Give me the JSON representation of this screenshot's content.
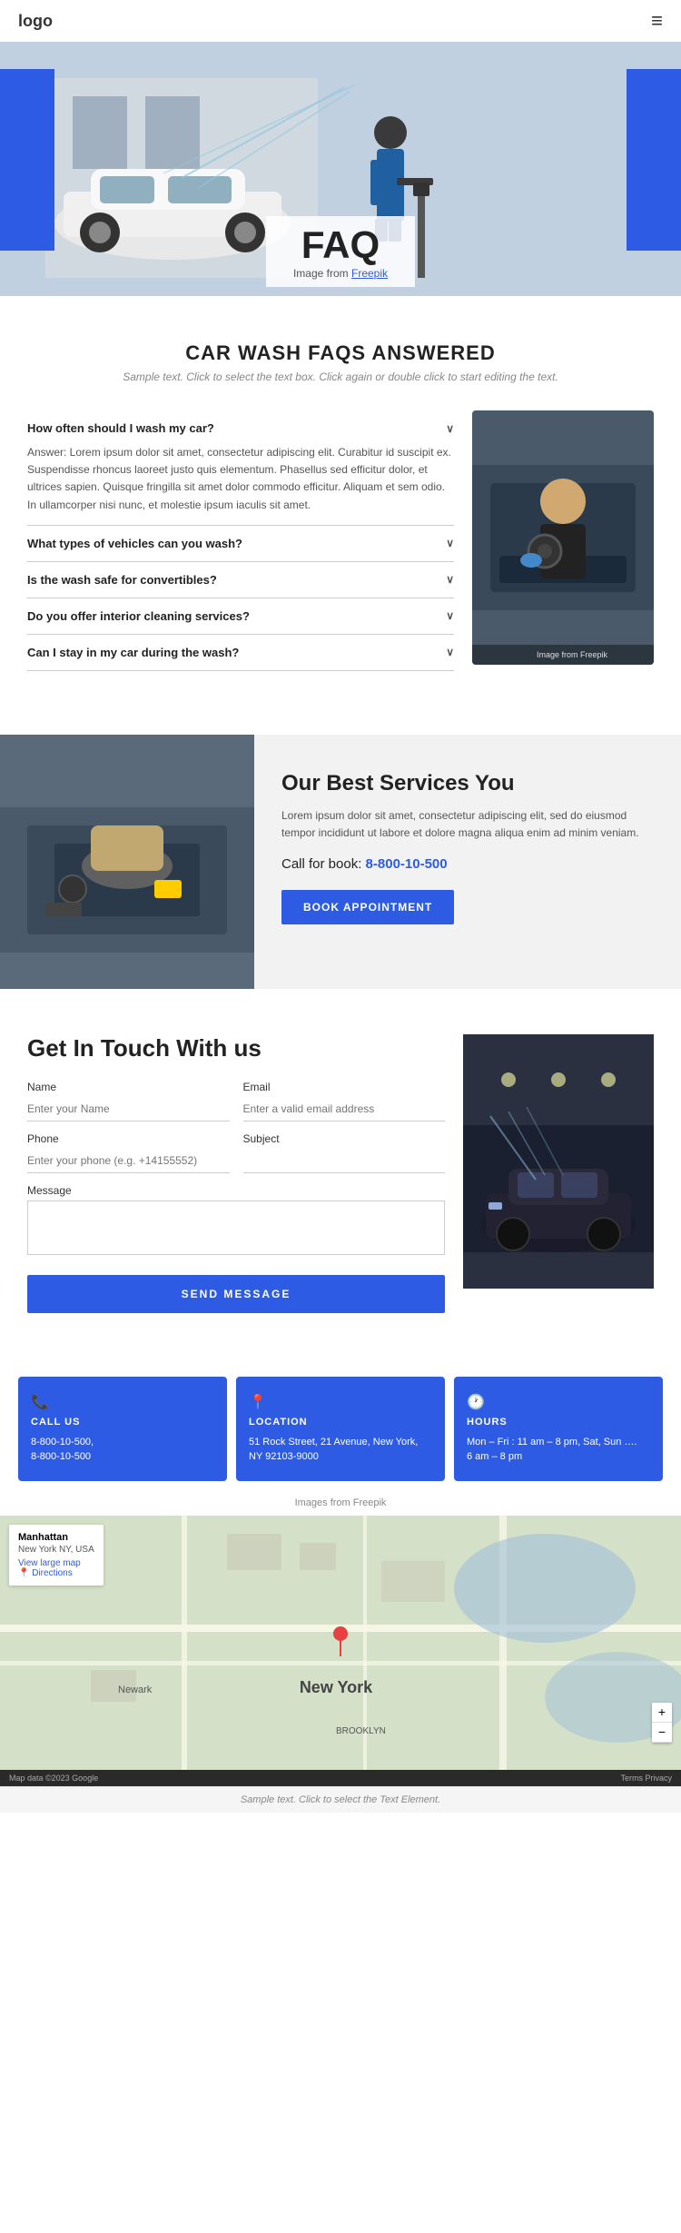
{
  "header": {
    "logo": "logo",
    "menu_icon": "≡"
  },
  "hero": {
    "title": "FAQ",
    "subtitle": "Image from Freepik",
    "subtitle_link": "Freepik"
  },
  "faq_section": {
    "heading": "CAR WASH FAQS ANSWERED",
    "subtext": "Sample text. Click to select the text box. Click again or double click to start editing the text.",
    "questions": [
      {
        "question": "How often should I wash my car?",
        "answer": "Answer: Lorem ipsum dolor sit amet, consectetur adipiscing elit. Curabitur id suscipit ex. Suspendisse rhoncus laoreet justo quis elementum. Phasellus sed efficitur dolor, et ultrices sapien. Quisque fringilla sit amet dolor commodo efficitur. Aliquam et sem odio. In ullamcorper nisi nunc, et molestie ipsum iaculis sit amet.",
        "open": true
      },
      {
        "question": "What types of vehicles can you wash?",
        "answer": "",
        "open": false
      },
      {
        "question": "Is the wash safe for convertibles?",
        "answer": "",
        "open": false
      },
      {
        "question": "Do you offer interior cleaning services?",
        "answer": "",
        "open": false
      },
      {
        "question": "Can I stay in my car during the wash?",
        "answer": "",
        "open": false
      }
    ],
    "image_caption": "Image from Freepik"
  },
  "services_section": {
    "title": "Our Best Services You",
    "text": "Lorem ipsum dolor sit amet, consectetur adipiscing elit, sed do eiusmod tempor incididunt ut labore et dolore magna aliqua enim ad minim veniam.",
    "call_label": "Call for book:",
    "phone": "8-800-10-500",
    "book_button": "BOOK APPOINTMENT"
  },
  "contact_section": {
    "title": "Get In Touch With us",
    "form": {
      "name_label": "Name",
      "name_placeholder": "Enter your Name",
      "email_label": "Email",
      "email_placeholder": "Enter a valid email address",
      "phone_label": "Phone",
      "phone_placeholder": "Enter your phone (e.g. +14155552)",
      "subject_label": "Subject",
      "subject_placeholder": "",
      "message_label": "Message",
      "message_placeholder": "",
      "send_button": "SEND MESSAGE"
    }
  },
  "info_cards": [
    {
      "icon": "📞",
      "title": "CALL US",
      "lines": [
        "8-800-10-500,",
        "8-800-10-500"
      ]
    },
    {
      "icon": "📍",
      "title": "LOCATION",
      "lines": [
        "51 Rock Street, 21 Avenue, New York, NY 92103-9000"
      ]
    },
    {
      "icon": "🕐",
      "title": "HOURS",
      "lines": [
        "Mon – Fri : 11 am – 8 pm, Sat, Sun ….",
        "6 am – 8 pm"
      ]
    }
  ],
  "images_credit": "Images from Freepik",
  "map": {
    "label": "New York",
    "overlay_title": "Manhattan",
    "overlay_address": "New York NY, USA",
    "overlay_link": "View large map",
    "footer_left": "Map data ©2023 Google",
    "footer_right": "Terms  Privacy"
  },
  "sample_text": "Sample text. Click to select the Text Element."
}
